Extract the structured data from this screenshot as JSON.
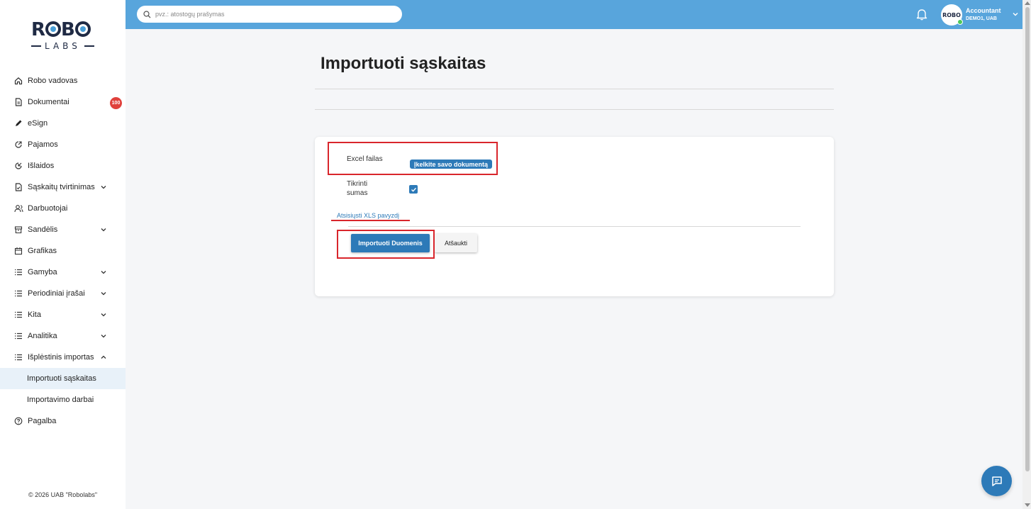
{
  "brand": {
    "logo_top": "ROBO",
    "logo_bottom": "LABS"
  },
  "sidebar": {
    "items": [
      {
        "label": "Robo vadovas",
        "icon": "home-icon"
      },
      {
        "label": "Dokumentai",
        "icon": "document-icon",
        "badge": "100"
      },
      {
        "label": "eSign",
        "icon": "pen-icon"
      },
      {
        "label": "Pajamos",
        "icon": "income-icon"
      },
      {
        "label": "Išlaidos",
        "icon": "expense-icon"
      },
      {
        "label": "Sąskaitų tvirtinimas",
        "icon": "invoice-approve-icon",
        "expandable": true
      },
      {
        "label": "Darbuotojai",
        "icon": "people-icon"
      },
      {
        "label": "Sandėlis",
        "icon": "warehouse-icon",
        "expandable": true
      },
      {
        "label": "Grafikas",
        "icon": "calendar-icon"
      },
      {
        "label": "Gamyba",
        "icon": "list-icon",
        "expandable": true
      },
      {
        "label": "Periodiniai įrašai",
        "icon": "list-icon",
        "expandable": true
      },
      {
        "label": "Kita",
        "icon": "list-icon",
        "expandable": true
      },
      {
        "label": "Analitika",
        "icon": "list-icon",
        "expandable": true
      },
      {
        "label": "Išplėstinis importas",
        "icon": "list-icon",
        "expanded": true
      },
      {
        "label": "Importuoti sąskaitas",
        "sub": true,
        "active": true
      },
      {
        "label": "Importavimo darbai",
        "sub": true
      },
      {
        "label": "Pagalba",
        "icon": "help-icon"
      }
    ],
    "footer": "© 2026 UAB \"Robolabs\""
  },
  "topbar": {
    "search_placeholder": "pvz.: atostogų prašymas",
    "user_name": "Accountant",
    "user_company": "DEMO1, UAB",
    "avatar_text": "ROBO"
  },
  "main": {
    "title": "Importuoti sąskaitas",
    "form": {
      "excel_label": "Excel failas",
      "upload_button": "Įkelkite savo dokumentą",
      "check_label": "Tikrinti sumas",
      "check_value": true,
      "download_link": "Atsisiųsti XLS pavyzdį",
      "import_button": "Importuoti Duomenis",
      "cancel_button": "Atšaukti"
    }
  },
  "colors": {
    "topbar": "#58a5dc",
    "primary": "#2d7ab8",
    "annotation": "#d9262c",
    "badge": "#e0413c"
  }
}
